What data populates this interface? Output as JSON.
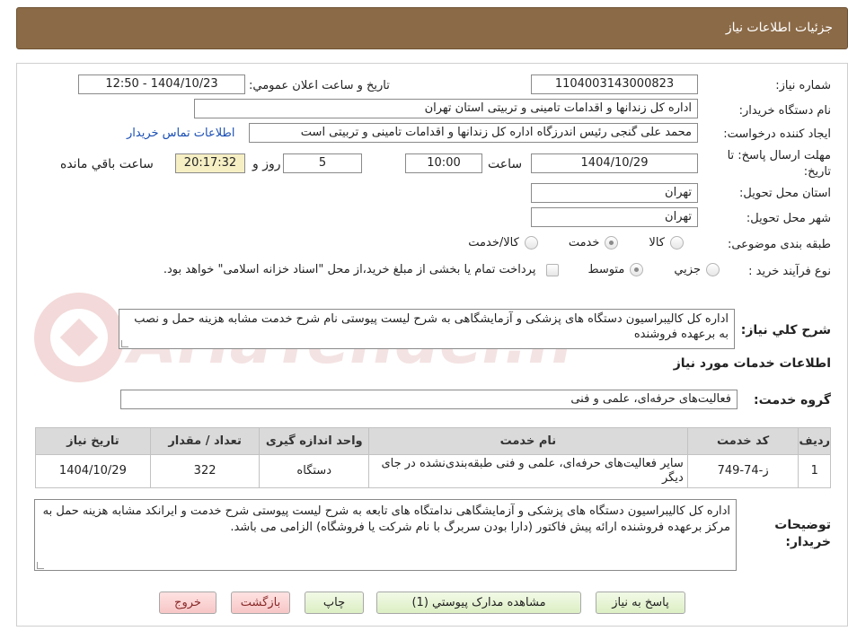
{
  "header": {
    "title": "جزئیات اطلاعات نیاز"
  },
  "watermark": {
    "text": "AriaTender.neT"
  },
  "fields": {
    "need_number_label": "شماره نیاز:",
    "need_number": "1104003143000823",
    "announce_label": "تاریخ و ساعت اعلان عمومي:",
    "announce_value": "1404/10/23 - 12:50",
    "buyer_org_label": "نام دستگاه خریدار:",
    "buyer_org": "اداره کل زندانها و اقدامات تامینی و تربیتی استان تهران",
    "requester_label": "ایجاد کننده درخواست:",
    "requester": "محمد علی گنجی رئیس اندرزگاه  اداره کل زندانها و اقدامات تامینی و تربیتی است",
    "contact_link": "اطلاعات تماس خریدار",
    "deadline_label_1": "مهلت ارسال پاسخ: تا",
    "deadline_label_2": "تاریخ:",
    "deadline_date": "1404/10/29",
    "time_label": "ساعت",
    "deadline_time": "10:00",
    "days_value": "5",
    "days_label": "روز و",
    "remaining_time": "20:17:32",
    "remaining_label": "ساعت باقي مانده",
    "province_label": "استان محل تحویل:",
    "province": "تهران",
    "city_label": "شهر محل تحویل:",
    "city": "تهران",
    "category_label": "طبقه بندی موضوعی:",
    "category_options": [
      "کالا",
      "خدمت",
      "کالا/خدمت"
    ],
    "category_selected": "خدمت",
    "process_label": "نوع فرآیند خرید :",
    "process_options": [
      "جزيي",
      "متوسط"
    ],
    "process_selected": "متوسط",
    "payment_note": "پرداخت تمام یا بخشی از مبلغ خرید،از محل \"اسناد خزانه اسلامی\" خواهد بود."
  },
  "summary": {
    "label": "شرح كلي نياز:",
    "text": "اداره کل کالیبراسیون دستگاه های پزشکی و آزمایشگاهی به شرح لیست پیوستی نام شرح خدمت مشابه هزینه حمل و نصب به برعهده فروشنده"
  },
  "services_section": {
    "title": "اطلاعات خدمات مورد نیاز"
  },
  "service_group": {
    "label": "گروه خدمت:",
    "value": "فعالیت‌های حرفه‌ای، علمی و فنی"
  },
  "table": {
    "headers": [
      "ردیف",
      "کد خدمت",
      "نام خدمت",
      "واحد اندازه گیری",
      "تعداد / مقدار",
      "تاریخ نیاز"
    ],
    "rows": [
      [
        "1",
        "ز-74-749",
        "سایر فعالیت‌های حرفه‌ای، علمی و فنی طبقه‌بندی‌نشده در جای دیگر",
        "دستگاه",
        "322",
        "1404/10/29"
      ]
    ]
  },
  "buyer_notes": {
    "label_1": "توضیحات",
    "label_2": "خریدار:",
    "text": "اداره کل کالیبراسیون دستگاه های پزشکی و آزمایشگاهی ندامتگاه های تابعه به شرح لیست پیوستی شرح خدمت و ایرانکد مشابه هزینه حمل به  مرکز برعهده فروشنده ارائه پیش فاکتور (دارا بودن سربرگ با نام شرکت یا فروشگاه) الزامی می باشد."
  },
  "buttons": {
    "reply": "پاسخ به نیاز",
    "attachments": "مشاهده مدارک پیوستي (1)",
    "print": "چاپ",
    "back": "بازگشت",
    "exit": "خروج"
  },
  "colors": {
    "header_bg": "#8b6a47",
    "remaining_bg": "#f6efc4",
    "link": "#1a4fb5",
    "table_header_bg": "#dadada",
    "button_green": "#dcefc4",
    "button_pink": "#f7c6c6"
  }
}
